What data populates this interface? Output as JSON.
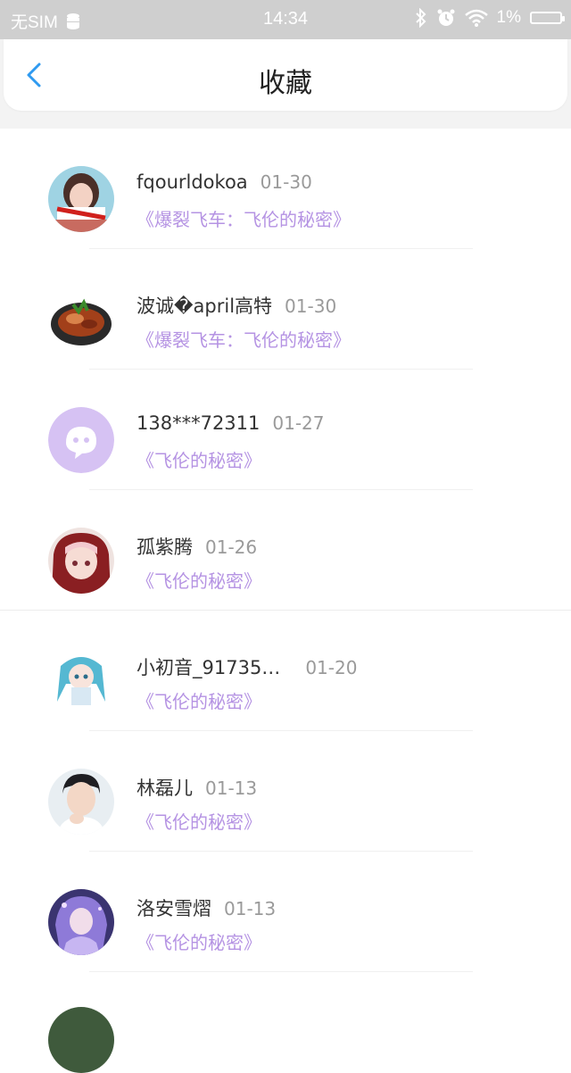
{
  "status_bar": {
    "carrier": "无SIM",
    "time": "14:34",
    "battery": "1%"
  },
  "header": {
    "title": "收藏"
  },
  "items": [
    {
      "name": "fqourldokoa",
      "date": "01-30",
      "book": "《爆裂飞车：飞伦的秘密》",
      "avatar": "avatar-girl-photo"
    },
    {
      "name": "波诚�april高特",
      "date": "01-30",
      "book": "《爆裂飞车：飞伦的秘密》",
      "avatar": "avatar-food"
    },
    {
      "name": "138***72311",
      "date": "01-27",
      "book": "《飞伦的秘密》",
      "avatar": "avatar-default-purple"
    },
    {
      "name": "孤紫腾",
      "date": "01-26",
      "book": "《飞伦的秘密》",
      "avatar": "avatar-anime-red"
    },
    {
      "name": "小初音_91735…",
      "date": "01-20",
      "book": "《飞伦的秘密》",
      "avatar": "avatar-anime-miku"
    },
    {
      "name": "林磊儿",
      "date": "01-13",
      "book": "《飞伦的秘密》",
      "avatar": "avatar-boy-photo"
    },
    {
      "name": "洛安雪熠",
      "date": "01-13",
      "book": "《飞伦的秘密》",
      "avatar": "avatar-anime-purple"
    }
  ],
  "colors": {
    "accent": "#2f9af0",
    "book": "#b593e3",
    "default_avatar": "#d6c2f3"
  }
}
